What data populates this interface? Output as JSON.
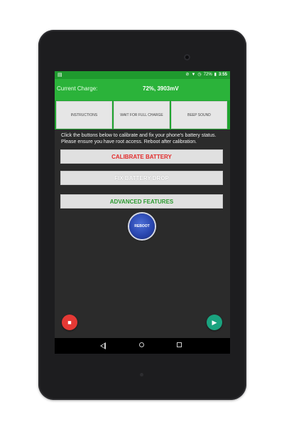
{
  "status_bar": {
    "left_icon": "notification-icon",
    "icons": [
      "dnd-icon",
      "wifi-icon",
      "alarm-icon"
    ],
    "battery": "72%",
    "time": "3:55"
  },
  "app_bar": {
    "charge_label": "Current Charge:",
    "charge_value": "72%, 3903mV"
  },
  "tabs": [
    {
      "label": "INSTRUCTIONS"
    },
    {
      "label": "WAIT FOR FULL CHARGE"
    },
    {
      "label": "BEEP SOUND"
    }
  ],
  "info_text": "Click the buttons below to calibrate and fix your phone's battery status. Please ensure you have root access. Reboot after calibration.",
  "buttons": {
    "calibrate": "CALIBRATE BATTERY",
    "fix_drop": "FIX BATTERY DROP",
    "advanced": "ADVANCED FEATURES",
    "reboot": "REBOOT"
  },
  "fabs": {
    "delete_icon": "trash-icon",
    "play_icon": "play-icon"
  },
  "colors": {
    "status_green": "#1f9a2e",
    "app_green": "#2bb33a",
    "calibrate_red": "#e32b2b",
    "advanced_green": "#2b9a2f",
    "reboot_blue": "#2a47b0",
    "fab_red": "#e53935",
    "fab_teal": "#1aa37f"
  }
}
